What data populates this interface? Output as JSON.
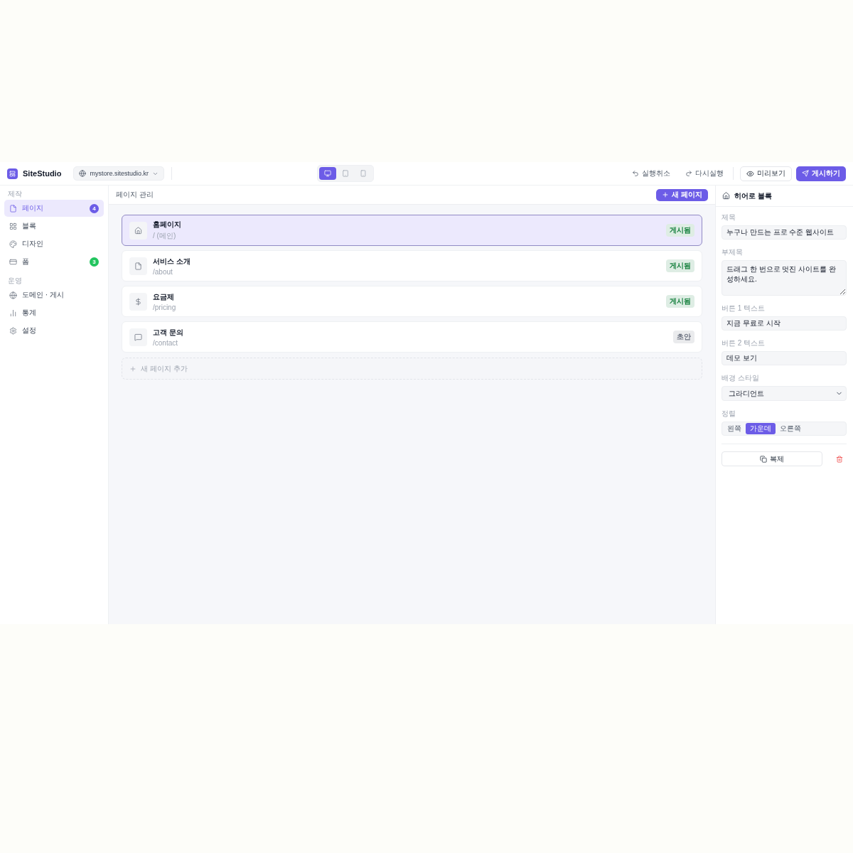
{
  "topbar": {
    "brand": "SiteStudio",
    "site": "mystore.sitestudio.kr",
    "devices": [
      {
        "selected": true
      },
      {
        "selected": false
      },
      {
        "selected": false
      }
    ],
    "undo": "실행취소",
    "redo": "다시실행",
    "preview": "미리보기",
    "publish": "게시하기"
  },
  "sidebar": {
    "sections": [
      {
        "title": "제작",
        "items": [
          {
            "label": "페이지",
            "selected": true,
            "badge": {
              "text": "4",
              "color": "#6c5ce7"
            }
          },
          {
            "label": "블록",
            "selected": false
          },
          {
            "label": "디자인",
            "selected": false
          },
          {
            "label": "폼",
            "selected": false,
            "badge": {
              "text": "3",
              "color": "#22c55e"
            }
          }
        ]
      },
      {
        "title": "운영",
        "items": [
          {
            "label": "도메인 · 게시",
            "selected": false
          },
          {
            "label": "통계",
            "selected": false
          },
          {
            "label": "설정",
            "selected": false
          }
        ]
      }
    ]
  },
  "main": {
    "title": "페이지 관리",
    "new_page": "새 페이지",
    "pages": [
      {
        "title": "홈페이지",
        "path": "/ (메인)",
        "selected": true,
        "status": {
          "label": "게시됨",
          "color": "#15803d"
        }
      },
      {
        "title": "서비스 소개",
        "path": "/about",
        "selected": false,
        "status": {
          "label": "게시됨",
          "color": "#15803d"
        }
      },
      {
        "title": "요금제",
        "path": "/pricing",
        "selected": false,
        "status": {
          "label": "게시됨",
          "color": "#15803d"
        }
      },
      {
        "title": "고객 문의",
        "path": "/contact",
        "selected": false,
        "status": {
          "label": "초안",
          "color": "#6b7280"
        }
      }
    ],
    "add_page": "새 페이지 추가"
  },
  "inspector": {
    "title": "히어로 블록",
    "fields": [
      {
        "kind": "text",
        "label": "제목",
        "value": "누구나 만드는 프로 수준 웹사이트"
      },
      {
        "kind": "textarea",
        "label": "부제목",
        "value": "드래그 한 번으로 멋진 사이트를 완성하세요."
      },
      {
        "kind": "text",
        "label": "버튼 1 텍스트",
        "value": "지금 무료로 시작"
      },
      {
        "kind": "text",
        "label": "버튼 2 텍스트",
        "value": "데모 보기"
      },
      {
        "kind": "select",
        "label": "배경 스타일",
        "value": "그라디언트"
      },
      {
        "kind": "segmented",
        "label": "정렬",
        "options": [
          {
            "label": "왼쪽",
            "selected": false
          },
          {
            "label": "가운데",
            "selected": true
          },
          {
            "label": "오른쪽",
            "selected": false
          }
        ]
      }
    ],
    "duplicate": "복제"
  }
}
